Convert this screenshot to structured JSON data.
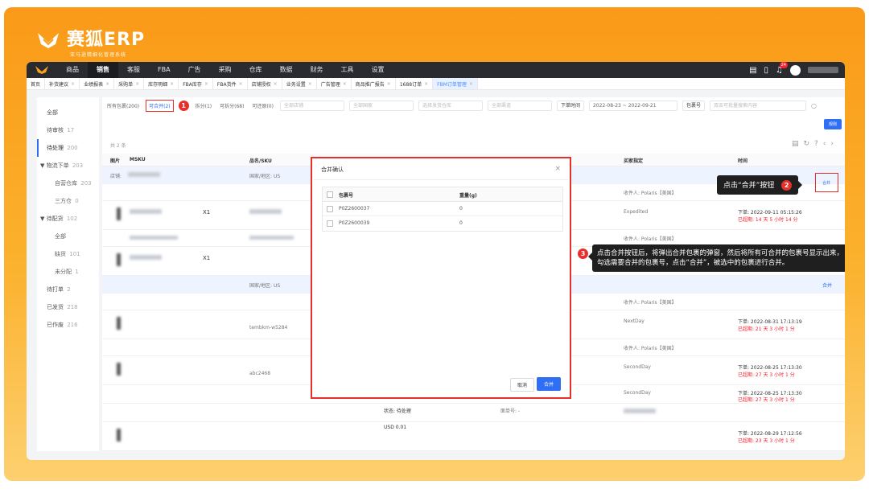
{
  "brand": {
    "name": "赛狐ERP",
    "subtitle": "亚马逊精细化管理系统"
  },
  "topnav": {
    "items": [
      "商品",
      "销售",
      "客服",
      "FBA",
      "广告",
      "采购",
      "仓库",
      "数据",
      "财务",
      "工具",
      "设置"
    ],
    "active": "销售",
    "badge": "24"
  },
  "tabs": [
    {
      "label": "首页"
    },
    {
      "label": "补货建议"
    },
    {
      "label": "业绩报表"
    },
    {
      "label": "采购单"
    },
    {
      "label": "库存明细"
    },
    {
      "label": "FBA库存"
    },
    {
      "label": "FBA货件"
    },
    {
      "label": "店铺授权"
    },
    {
      "label": "业务设置"
    },
    {
      "label": "广告管理"
    },
    {
      "label": "商品推广报告"
    },
    {
      "label": "1688订单"
    },
    {
      "label": "FBM订单管理"
    }
  ],
  "sidebar": {
    "items": [
      {
        "label": "全部",
        "count": ""
      },
      {
        "label": "待审核",
        "count": "17"
      },
      {
        "label": "待处理",
        "count": "200"
      },
      {
        "label": "▼ 物流下单",
        "count": "203"
      },
      {
        "label": "自营仓库",
        "count": "203"
      },
      {
        "label": "三方仓",
        "count": "0"
      },
      {
        "label": "▼ 待配货",
        "count": "102"
      },
      {
        "label": "全部",
        "count": ""
      },
      {
        "label": "缺货",
        "count": "101"
      },
      {
        "label": "未分配",
        "count": "1"
      },
      {
        "label": "待打单",
        "count": "2"
      },
      {
        "label": "已发货",
        "count": "218"
      },
      {
        "label": "已作废",
        "count": "216"
      }
    ]
  },
  "filters": {
    "all_packages": "所有包裹(200)",
    "mergeable": "可合并(2)",
    "marker1": "1",
    "f3": "拆分(1)",
    "f4": "可拆分(68)",
    "f5": "可还原(0)",
    "shop": "全部店铺",
    "country": "全部国家",
    "warehouse": "选择发货仓库",
    "channel": "全部渠道",
    "time_type": "下单时间",
    "date_range": "2022-08-23 ~ 2022-09-21",
    "package_no": "包裹号",
    "search_placeholder": "双击可批量搜索内容",
    "rule_btn": "规则",
    "tip_btn": "高级筛选"
  },
  "table": {
    "count": "共 2 条",
    "headers": {
      "image": "图片",
      "msku": "MSKU",
      "name": "品名/SKU",
      "buyer": "买家指定",
      "time": "时间"
    },
    "rows_text": {
      "shop_label": "店铺:",
      "country": "国家/地区: US",
      "recipient": "收件人: Polaris【美国】",
      "expedited": "Expedited",
      "order_time_1": "下单: 2022-09-11 05:15:26",
      "overdue_1": "已超期: 14 天 5 小时 14 分",
      "x1": "X1",
      "nextday": "NextDay",
      "order_time_2": "下单: 2022-08-31 17:13:19",
      "overdue_2": "已超期: 21 天 3 小时 1 分",
      "sku_1": "tembkm-w5284",
      "secondday": "SecondDay",
      "sku_2": "abc2468",
      "order_time_3": "下单: 2022-08-25 17:13:30",
      "overdue_3": "已超期: 27 天 3 小时 1 分",
      "order_time_4": "下单: 2022-08-25 17:13:30",
      "overdue_4": "已超期: 27 天 3 小时 1 分",
      "usd": "USD 0.01",
      "status": "状态: 待处理",
      "logistics": "面单号: -",
      "order_time_5": "下单: 2022-08-29 17:12:56",
      "overdue_5": "已超期: 23 天 3 小时 1 分",
      "merge_link": "合并"
    }
  },
  "modal": {
    "title": "合并确认",
    "col_package": "包裹号",
    "col_weight": "重量(g)",
    "rows": [
      {
        "package": "P0Z2600037",
        "weight": "0"
      },
      {
        "package": "P0Z2600039",
        "weight": "0"
      }
    ],
    "cancel": "取消",
    "confirm": "合并"
  },
  "callouts": {
    "marker2": "2",
    "step2": "点击“合并”按钮",
    "marker3": "3",
    "step3": "点击合并按钮后，将弹出合并包裹的弹窗，然后将所有可合并的包裹号显示出来，勾选需要合并的包裹号，点击“合并”，被选中的包裹进行合并。"
  },
  "colors": {
    "brand_orange": "#fa9a18",
    "primary_blue": "#2f6ff6",
    "marker_red": "#e8302a",
    "nav_dark": "#2a2b30"
  }
}
